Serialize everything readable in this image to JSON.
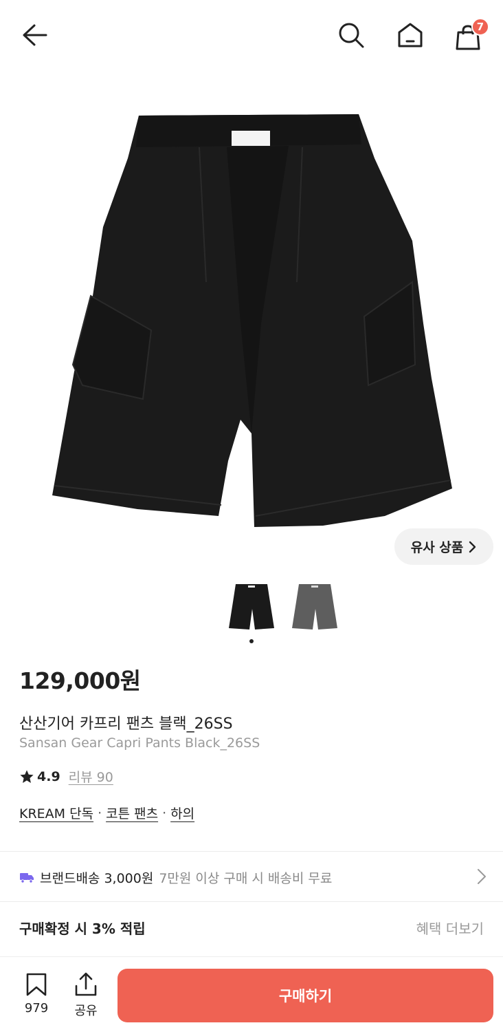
{
  "header": {
    "back_icon": "arrow-left-icon",
    "search_icon": "search-icon",
    "home_icon": "home-icon",
    "cart_icon": "shopping-bag-icon",
    "cart_count": "7"
  },
  "product": {
    "similar_label": "유사 상품",
    "similar_icon": "chevron-right-icon",
    "thumbnails": [
      "black",
      "gray"
    ],
    "price": "129,000원",
    "name_ko": "산산기어 카프리 팬츠 블랙_26SS",
    "name_en": "Sansan Gear Capri Pants Black_26SS",
    "rating_score": "4.9",
    "review_label": "리뷰 90",
    "tags": [
      "KREAM 단독",
      "코튼 팬츠",
      "하의"
    ],
    "tag_separator": "·"
  },
  "shipping": {
    "main": "브랜드배송 3,000원",
    "sub": "7만원 이상 구매 시 배송비 무료"
  },
  "benefit": {
    "label": "구매확정 시 3% 적립",
    "more": "혜택 더보기"
  },
  "bottom": {
    "bookmark_count": "979",
    "share_label": "공유",
    "buy_label": "구매하기"
  },
  "colors": {
    "accent": "#ef6253",
    "text": "#222222",
    "muted": "#9a9a9a",
    "truck": "#7b68ee"
  }
}
